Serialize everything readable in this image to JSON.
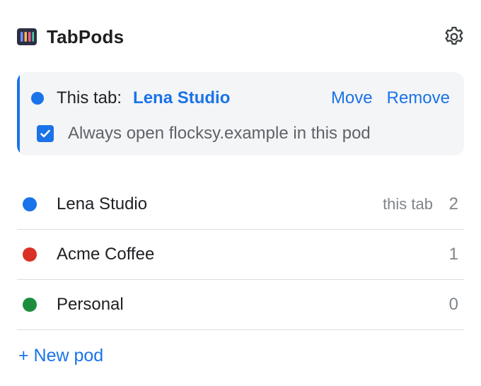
{
  "app": {
    "title": "TabPods",
    "logo_icon": "bars-logo-icon",
    "settings_icon": "gear-icon"
  },
  "current_tab": {
    "label": "This tab:",
    "pod_name": "Lena Studio",
    "pod_color": "#1a73e8",
    "move_label": "Move",
    "remove_label": "Remove",
    "always_open_checked": true,
    "always_open_label": "Always open flocksy.example in this pod"
  },
  "pods": [
    {
      "name": "Lena Studio",
      "color": "#1a73e8",
      "badge": "this tab",
      "count": "2"
    },
    {
      "name": "Acme Coffee",
      "color": "#d93025",
      "badge": "",
      "count": "1"
    },
    {
      "name": "Personal",
      "color": "#1e8e3e",
      "badge": "",
      "count": "0"
    }
  ],
  "new_pod_label": "+ New pod",
  "colors": {
    "accent": "#1a73e8",
    "card_bg": "#f4f5f7",
    "divider": "#dadce0",
    "muted_text": "#80868b"
  }
}
